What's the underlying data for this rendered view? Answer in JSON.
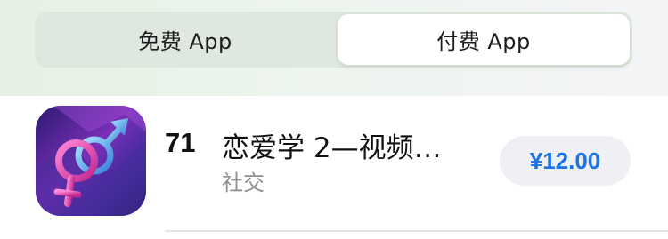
{
  "tabs": {
    "free_label": "免费 App",
    "paid_label": "付费 App",
    "selected": "paid"
  },
  "app": {
    "rank": "71",
    "title": "恋爱学 2—视频…",
    "category": "社交",
    "price": "¥12.00",
    "icon": "male-female-symbol-icon"
  },
  "colors": {
    "accent": "#1c73e8",
    "price_bg": "#eef0f4",
    "segment_bg": "#dfe8df"
  }
}
